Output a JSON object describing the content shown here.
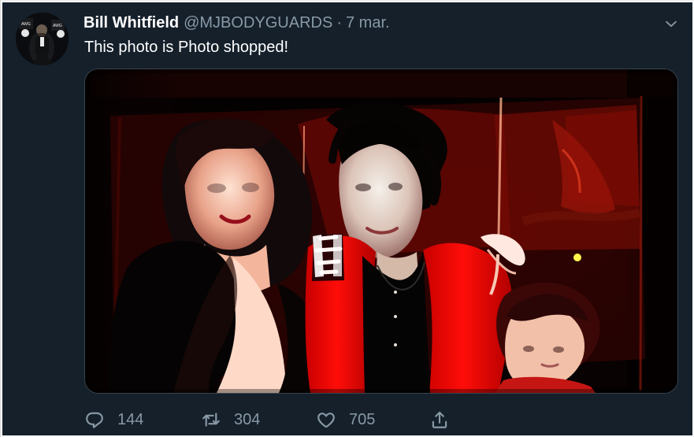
{
  "tweet": {
    "author": {
      "name": "Bill Whitfield",
      "handle": "@MJBODYGUARDS"
    },
    "separator": "·",
    "timestamp": "7 mar.",
    "text": "This photo is Photo shopped!",
    "media": {
      "alt": "Photo of three people posing together"
    },
    "actions": {
      "reply": "144",
      "retweet": "304",
      "like": "705"
    },
    "icons": {
      "avatar": "avatar",
      "more": "chevron-down-icon",
      "reply": "reply-icon",
      "retweet": "retweet-icon",
      "like": "heart-icon",
      "share": "share-icon"
    }
  },
  "colors": {
    "background": "#15202b",
    "primary_text": "#ffffff",
    "secondary_text": "#8899a6",
    "border": "#38444d"
  }
}
